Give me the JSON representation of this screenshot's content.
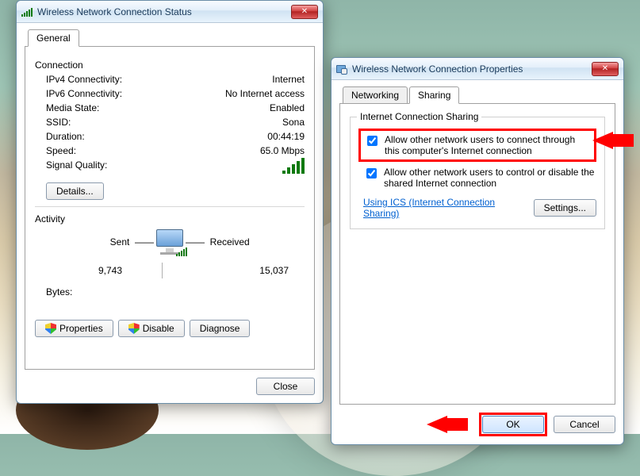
{
  "statusDialog": {
    "title": "Wireless Network Connection Status",
    "tab": "General",
    "connectionHeader": "Connection",
    "rows": {
      "ipv4_label": "IPv4 Connectivity:",
      "ipv4_value": "Internet",
      "ipv6_label": "IPv6 Connectivity:",
      "ipv6_value": "No Internet access",
      "media_label": "Media State:",
      "media_value": "Enabled",
      "ssid_label": "SSID:",
      "ssid_value": "Sona",
      "duration_label": "Duration:",
      "duration_value": "00:44:19",
      "speed_label": "Speed:",
      "speed_value": "65.0 Mbps",
      "signal_label": "Signal Quality:"
    },
    "details_btn": "Details...",
    "activityHeader": "Activity",
    "sent_label": "Sent",
    "received_label": "Received",
    "bytes_label": "Bytes:",
    "sent_value": "9,743",
    "received_value": "15,037",
    "properties_btn": "Properties",
    "disable_btn": "Disable",
    "diagnose_btn": "Diagnose",
    "close_btn": "Close"
  },
  "propsDialog": {
    "title": "Wireless Network Connection Properties",
    "tab_networking": "Networking",
    "tab_sharing": "Sharing",
    "group_legend": "Internet Connection Sharing",
    "chk1": "Allow other network users to connect through this computer's Internet connection",
    "chk2": "Allow other network users to control or disable the shared Internet connection",
    "link": "Using ICS (Internet Connection Sharing)",
    "settings_btn": "Settings...",
    "ok_btn": "OK",
    "cancel_btn": "Cancel"
  }
}
